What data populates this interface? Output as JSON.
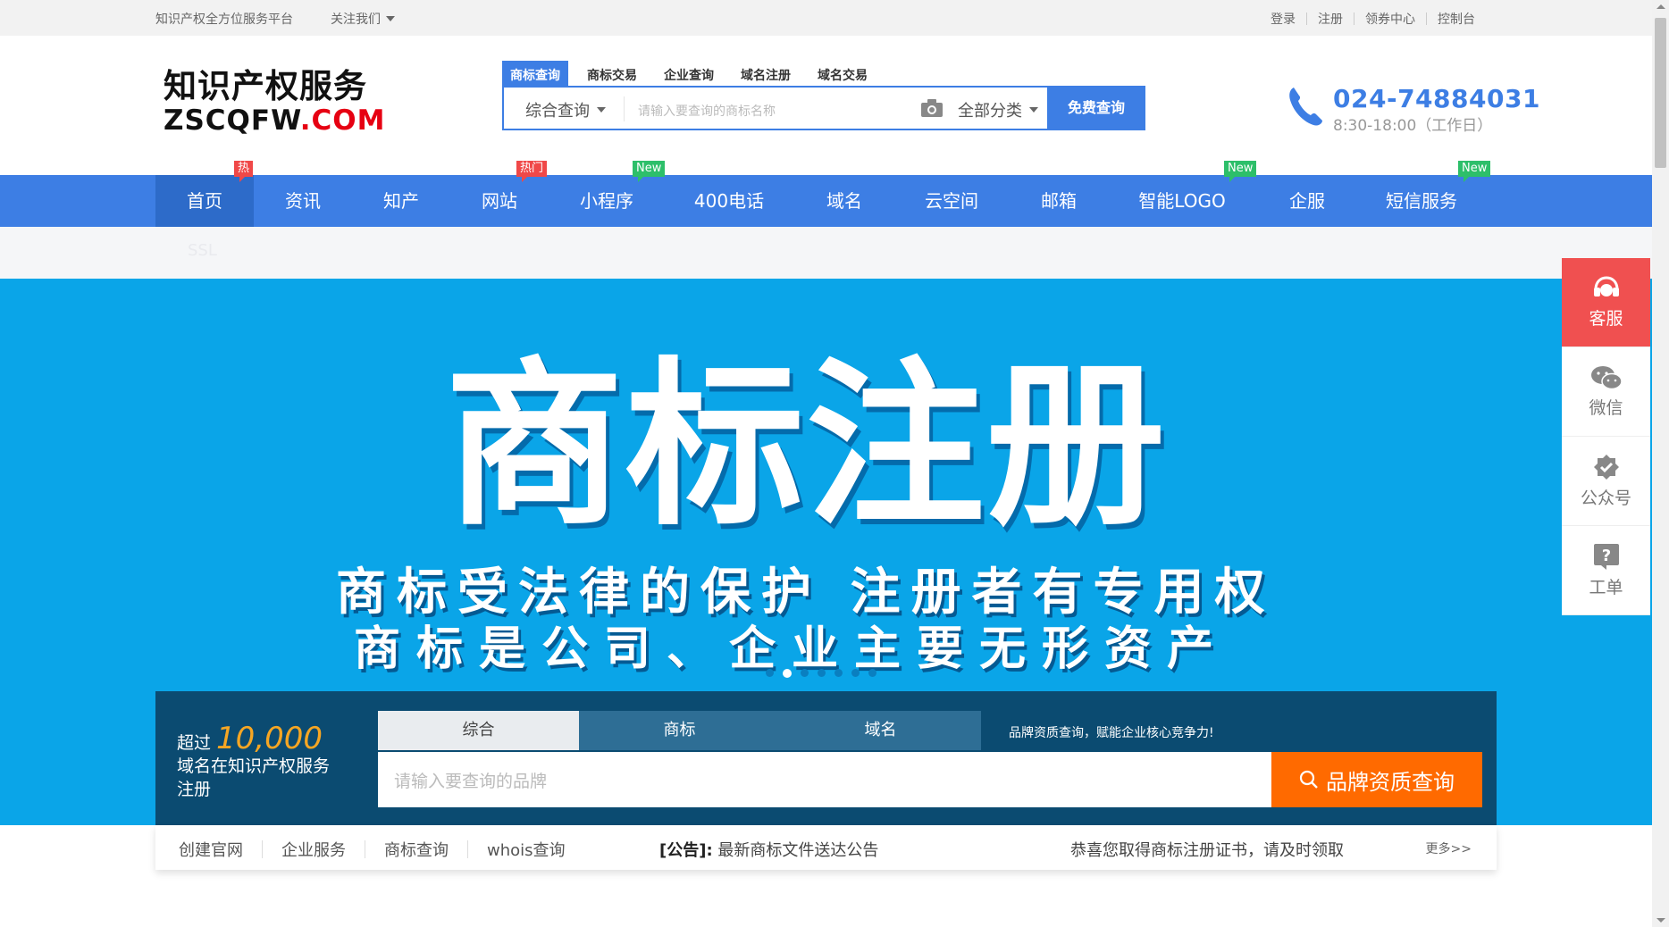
{
  "topbar": {
    "platform": "知识产权全方位服务平台",
    "follow": "关注我们",
    "links": [
      "登录",
      "注册",
      "领券中心",
      "控制台"
    ]
  },
  "logo": {
    "line1": "知识产权服务",
    "line2a": "ZSCQFW",
    "line2b": ".COM"
  },
  "search": {
    "tabs": [
      "商标查询",
      "商标交易",
      "企业查询",
      "域名注册",
      "域名交易"
    ],
    "category": "综合查询",
    "placeholder": "请输入要查询的商标名称",
    "all_category": "全部分类",
    "button": "免费查询"
  },
  "contact": {
    "phone": "024-74884031",
    "hours": "8:30-18:00（工作日）"
  },
  "nav": {
    "items": [
      "首页",
      "资讯",
      "知产",
      "网站",
      "小程序",
      "400电话",
      "域名",
      "云空间",
      "邮箱",
      "智能LOGO",
      "企服",
      "短信服务"
    ],
    "badges": {
      "hot": "热",
      "hot2": "热门",
      "new": "New"
    },
    "sub": "SSL"
  },
  "banner": {
    "title": "商标注册",
    "line1": "商标受法律的保护 注册者有专用权",
    "line2": "商标是公司、企业主要无形资产"
  },
  "query": {
    "over": "超过",
    "count": "10,000",
    "desc1": "域名在知识产权服务",
    "desc2": "注册",
    "tabs": [
      "综合",
      "商标",
      "域名"
    ],
    "slogan": "品牌资质查询，赋能企业核心竞争力!",
    "placeholder": "请输入要查询的品牌",
    "button": "品牌资质查询"
  },
  "bottom": {
    "links": [
      "创建官网",
      "企业服务",
      "商标查询",
      "whois查询"
    ],
    "notice_tag": "[公告]:",
    "notice": "最新商标文件送达公告",
    "message": "恭喜您取得商标注册证书，请及时领取",
    "more": "更多>>"
  },
  "side": {
    "items": [
      "客服",
      "微信",
      "公众号",
      "工单"
    ]
  },
  "colors": {
    "primary": "#3d7ee4",
    "banner": "#0aa5e8",
    "orange": "#ff6a00",
    "panel": "#0b4b71"
  }
}
